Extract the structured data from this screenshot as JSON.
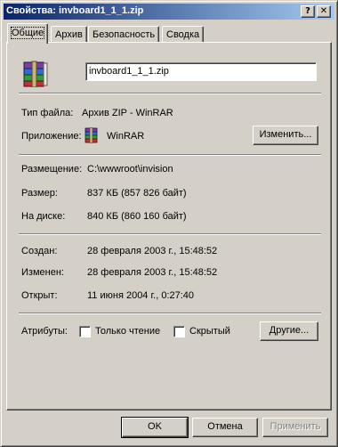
{
  "window": {
    "title": "Свойства: invboard1_1_1.zip",
    "help_glyph": "?",
    "close_glyph": "✕"
  },
  "tabs": [
    {
      "label": "Общие",
      "active": true
    },
    {
      "label": "Архив",
      "active": false
    },
    {
      "label": "Безопасность",
      "active": false
    },
    {
      "label": "Сводка",
      "active": false
    }
  ],
  "general": {
    "file_name": "invboard1_1_1.zip",
    "file_icon": "winrar-archive-icon",
    "type_label": "Тип файла:",
    "type_value": "Архив ZIP - WinRAR",
    "app_label": "Приложение:",
    "app_value": "WinRAR",
    "app_icon": "winrar-icon",
    "change_button": "Изменить...",
    "location_label": "Размещение:",
    "location_value": "C:\\wwwroot\\invision",
    "size_label": "Размер:",
    "size_value": "837 КБ (857 826 байт)",
    "disk_label": "На диске:",
    "disk_value": "840 КБ (860 160 байт)",
    "created_label": "Создан:",
    "created_value": "28 февраля 2003 г., 15:48:52",
    "modified_label": "Изменен:",
    "modified_value": "28 февраля 2003 г., 15:48:52",
    "opened_label": "Открыт:",
    "opened_value": "11 июня 2004 г., 0:27:40",
    "attributes_label": "Атрибуты:",
    "readonly_label": "Только чтение",
    "readonly_checked": false,
    "hidden_label": "Скрытый",
    "hidden_checked": false,
    "other_button": "Другие..."
  },
  "footer": {
    "ok": "OK",
    "cancel": "Отмена",
    "apply": "Применить"
  },
  "colors": {
    "title_start": "#0a246a",
    "title_end": "#a6caf0",
    "face": "#d4d0c8"
  }
}
